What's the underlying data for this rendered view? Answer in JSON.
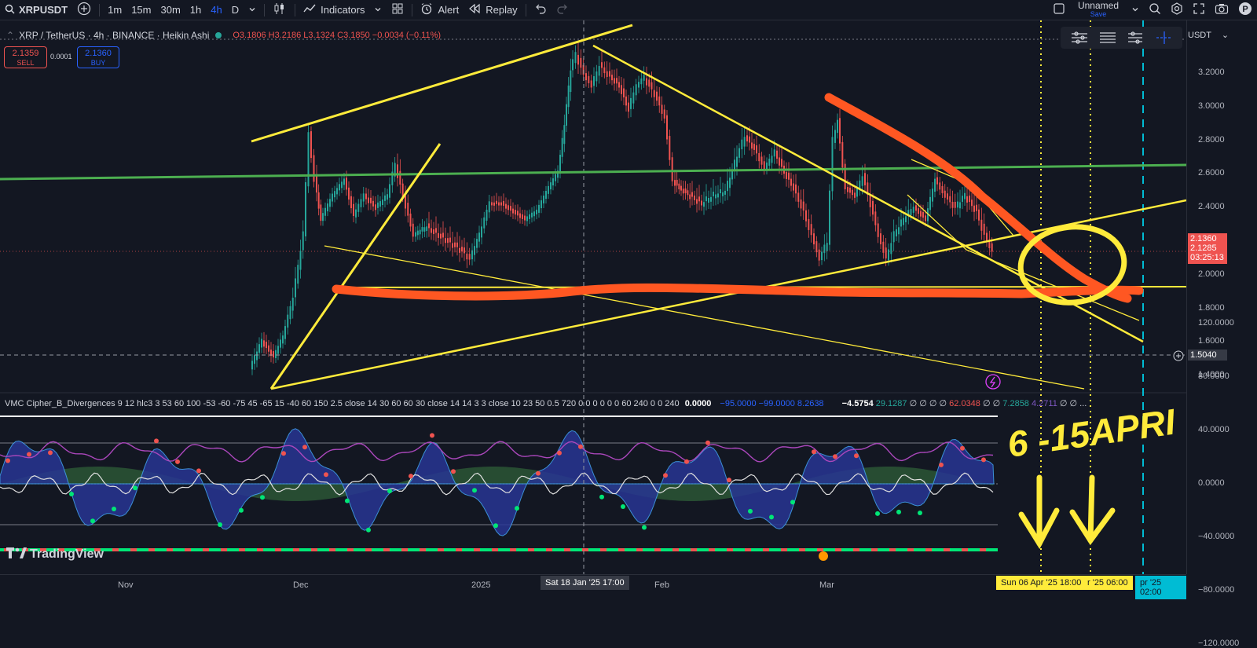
{
  "toolbar": {
    "symbol": "XRPUSDT",
    "intervals": [
      "1m",
      "15m",
      "30m",
      "1h",
      "4h",
      "D"
    ],
    "active_interval": "4h",
    "indicators_label": "Indicators",
    "alert_label": "Alert",
    "replay_label": "Replay",
    "layout_name": "Unnamed",
    "layout_status": "Save"
  },
  "legend": {
    "title": "XRP / TetherUS · 4h · BINANCE · Heikin Ashi",
    "open": "O3.1806",
    "high": "H3.2186",
    "low": "L3.1324",
    "close": "C3.1850",
    "change": "−0.0034 (−0.11%)"
  },
  "trade": {
    "sell_price": "2.1359",
    "sell_label": "SELL",
    "buy_price": "2.1360",
    "buy_label": "BUY",
    "spread": "0.0001"
  },
  "price_axis": {
    "currency": "USDT",
    "ticks": [
      "3.2000",
      "3.0000",
      "2.8000",
      "2.6000",
      "2.4000",
      "2.2000",
      "2.0000",
      "1.8000",
      "1.6000",
      "1.4000"
    ],
    "last_price": "2.1360",
    "last_price_2": "2.1285",
    "countdown": "03:25:13",
    "crosshair_price": "1.5040"
  },
  "indicator": {
    "name": "VMC Cipher_B_Divergences 9 12 hlc3 3 53 60 100 -53 -60 -75 45 -65 15 -40 60 150 2.5 close 14 30 60 60 30 close 14 14 3 3 close 10 23 50 0.5 720 0 0 0 0 0 0 60 240 0 0 240",
    "v1": "0.0000",
    "v2": "−95.0000",
    "v3": "−99.0000",
    "v4": "8.2638",
    "v5": "−4.5754",
    "v6": "29.1287",
    "v7": "∅ ∅ ∅ ∅",
    "v8": "62.0348",
    "v9": "∅ ∅",
    "v10": "7.2858",
    "v11": "4.2711",
    "v12": "∅ ∅ ...",
    "ticks": [
      "120.0000",
      "80.0000",
      "40.0000",
      "0.0000",
      "−40.0000",
      "−80.0000",
      "−120.0000"
    ]
  },
  "time_axis": {
    "labels": [
      "Nov",
      "Dec",
      "2025",
      "Feb",
      "Mar"
    ],
    "crosshair": "Sat 18 Jan '25   17:00",
    "range_start": "Sun 06 Apr '25   18:00",
    "range_mid": "r '25   06:00",
    "range_end": "pr '25   02:00"
  },
  "annotation": {
    "handwriting": "6 -15APRI"
  },
  "branding": {
    "logo": "TradingView"
  },
  "colors": {
    "background": "#131722",
    "yellow": "#ffeb3b",
    "orange": "#ff5722",
    "green": "#4caf50",
    "up": "#26a69a",
    "down": "#ef5350"
  }
}
